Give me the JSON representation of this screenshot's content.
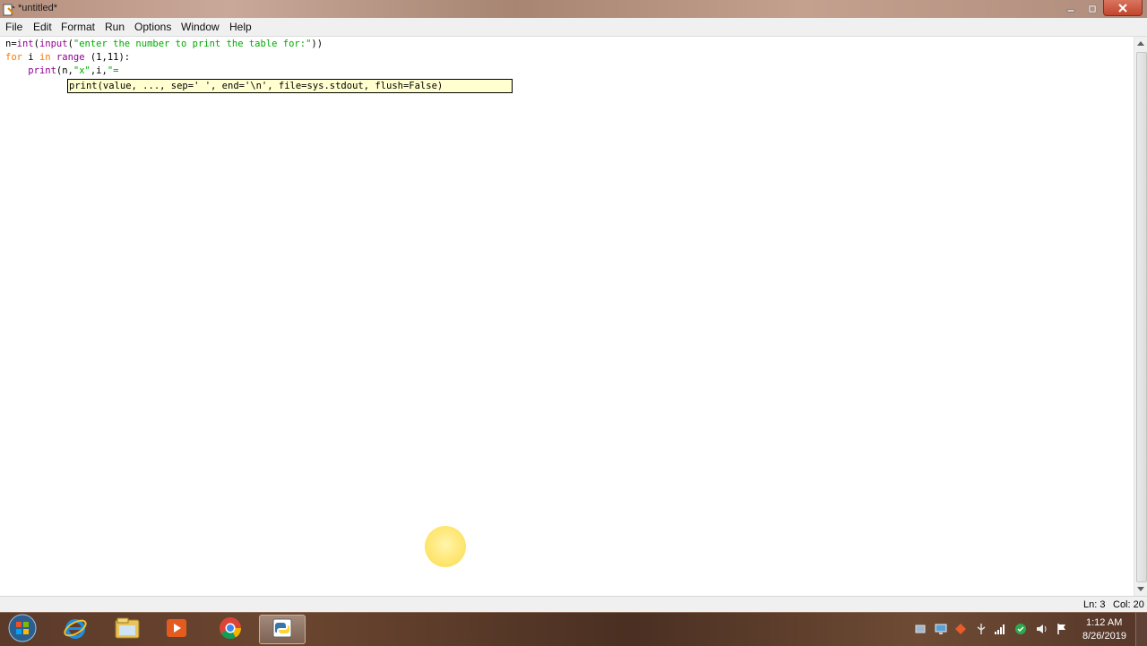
{
  "window": {
    "title": "*untitled*",
    "controls": {
      "minimize_icon": "minimize-icon",
      "maximize_icon": "maximize-icon",
      "close_icon": "close-icon"
    }
  },
  "menubar": {
    "items": [
      "File",
      "Edit",
      "Format",
      "Run",
      "Options",
      "Window",
      "Help"
    ]
  },
  "editor": {
    "lines": [
      {
        "t1": "n=",
        "t2": "int",
        "t3": "(",
        "t4": "input",
        "t5": "(",
        "t6": "\"enter the number to print the table for:\"",
        "t7": "))"
      },
      {
        "t1": "for",
        "t2": " i ",
        "t3": "in",
        "t4": " ",
        "t5": "range",
        "t6": " (1,11):"
      },
      {
        "t1": "    ",
        "t2": "print",
        "t3": "(n,",
        "t4": "\"x\"",
        "t5": ",i,",
        "t6": "\"="
      }
    ],
    "calltip": "print(value, ..., sep=' ', end='\\n', file=sys.stdout, flush=False)"
  },
  "statusbar": {
    "line": "Ln: 3",
    "column": "Col: 20"
  },
  "taskbar": {
    "apps": [
      "start-orb-icon",
      "internet-explorer-icon",
      "file-explorer-icon",
      "media-player-icon",
      "chrome-icon",
      "python-idle-icon"
    ],
    "clock": {
      "time": "1:12 AM",
      "date": "8/26/2019"
    }
  },
  "colors": {
    "keyword": "#ff7700",
    "builtin": "#900090",
    "string": "#00aa00",
    "calltip_bg": "#ffffd0"
  }
}
